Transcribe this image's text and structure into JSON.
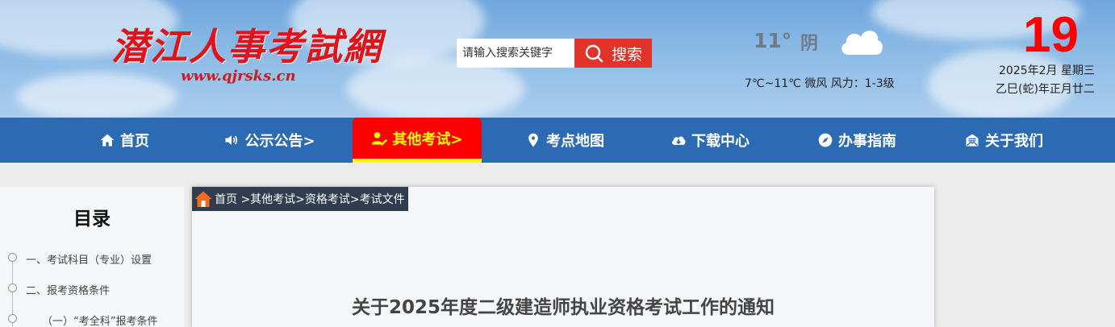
{
  "header": {
    "logo_text": "潜江人事考試網",
    "logo_url": "www.qjrsks.cn"
  },
  "search": {
    "placeholder": "请输入搜索关键字",
    "button_label": "搜索"
  },
  "weather": {
    "temp": "11°",
    "condition": "阴",
    "icon": "cloud-icon",
    "detail": "7℃~11℃ 微风 风力：1-3级"
  },
  "calendar": {
    "day": "19",
    "date": "2025年2月 星期三",
    "lunar": "乙巳(蛇)年正月廿二"
  },
  "nav": {
    "items": [
      {
        "label": "首页",
        "icon": "home-icon"
      },
      {
        "label": "公示公告>",
        "icon": "speaker-icon"
      },
      {
        "label": "其他考试>",
        "icon": "user-edit-icon",
        "active": true
      },
      {
        "label": "考点地图",
        "icon": "map-pin-icon"
      },
      {
        "label": "下载中心",
        "icon": "cloud-download-icon"
      },
      {
        "label": "办事指南",
        "icon": "compass-icon"
      },
      {
        "label": "关于我们",
        "icon": "envelope-icon"
      }
    ]
  },
  "toc": {
    "title": "目录",
    "items": [
      "一、考试科目（专业）设置",
      "二、报考资格条件",
      "（一）“考全科”报考条件"
    ]
  },
  "breadcrumb": {
    "text": "首页 >其他考试>资格考试>考试文件",
    "icon": "home-icon"
  },
  "article": {
    "title": "关于2025年度二级建造师执业资格考试工作的通知"
  },
  "colors": {
    "nav_bg": "#2c6bb3",
    "nav_active_bg": "#ff0000",
    "nav_active_text": "#ffff00",
    "search_button": "#e2332b",
    "day_number": "#ff0000",
    "logo": "#e0121a",
    "breadcrumb_bg": "#2f3d4f"
  }
}
